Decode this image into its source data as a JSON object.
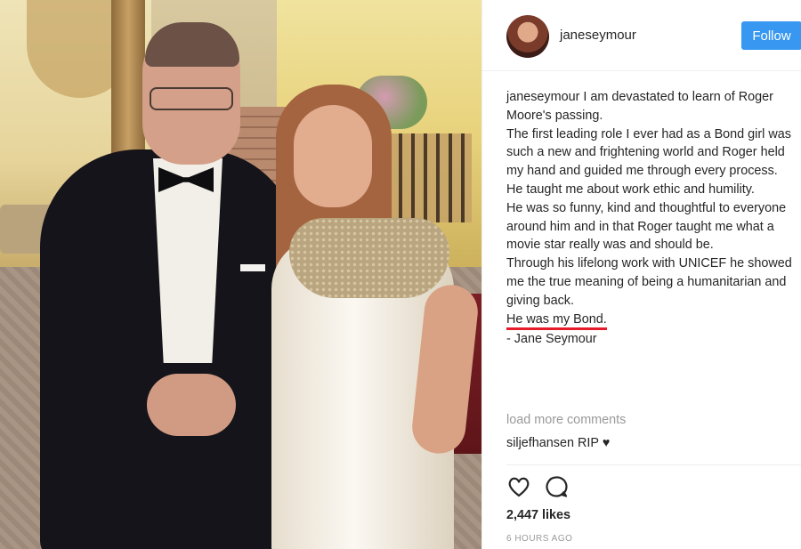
{
  "post": {
    "author": {
      "username": "janeseymour",
      "follow_label": "Follow"
    },
    "caption": {
      "username": "janeseymour",
      "lines": [
        "I am devastated to learn of Roger Moore's passing.",
        "The first leading role I ever had as a Bond girl was such a new and frightening world and Roger held my hand and guided me through every process.",
        "He taught me about work ethic and humility.",
        "He was so funny, kind and thoughtful to everyone around him and in that Roger taught me what a movie star really was and should be.",
        "Through his lifelong work with UNICEF he showed me the true meaning of being a humanitarian and giving back."
      ],
      "highlight": "He was my Bond.",
      "signature": "- Jane Seymour"
    },
    "load_more_label": "load more comments",
    "comments": [
      {
        "username": "siljefhansen",
        "text": "RIP ♥"
      }
    ],
    "likes": "2,447 likes",
    "time": "6 HOURS AGO",
    "icons": [
      "heart-icon",
      "comment-icon"
    ],
    "colors": {
      "follow_button": "#3897f0",
      "underline": "#e41c2c"
    }
  }
}
